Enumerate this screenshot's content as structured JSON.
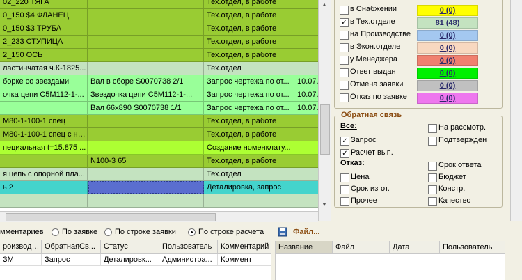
{
  "grid": {
    "rows": [
      {
        "cells": [
          "02_220 ТЯГА",
          "",
          "Тех.отдел, в работе",
          ""
        ],
        "color": "#99cc33"
      },
      {
        "cells": [
          "0_150 $4 ФЛАНЕЦ",
          "",
          "Тех.отдел, в работе",
          ""
        ],
        "color": "#99cc33"
      },
      {
        "cells": [
          "0_150 $3 ТРУБА",
          "",
          "Тех.отдел, в работе",
          ""
        ],
        "color": "#99cc33"
      },
      {
        "cells": [
          "2_233 СТУПИЦА",
          "",
          "Тех.отдел, в работе",
          ""
        ],
        "color": "#99cc33"
      },
      {
        "cells": [
          "2_150 ОСЬ",
          "",
          "Тех.отдел, в работе",
          ""
        ],
        "color": "#99cc33"
      },
      {
        "cells": [
          "ластинчатая ч.К-1825...",
          "",
          "Тех.отдел",
          ""
        ],
        "color": "#c4e3c0"
      },
      {
        "cells": [
          "борке со звездами",
          "Вал в сборе S0070738 2/1",
          "Запрос чертежа по от...",
          "10.07."
        ],
        "color": "#99ff99"
      },
      {
        "cells": [
          "очка цепи C5M112-1-...",
          "Звездочка цепи C5M112-1-...",
          "Запрос чертежа по от...",
          "10.07."
        ],
        "color": "#99ff99"
      },
      {
        "cells": [
          "",
          "Вал 66x890 S0070738 1/1",
          "Запрос чертежа по от...",
          "10.07."
        ],
        "color": "#99ff99"
      },
      {
        "cells": [
          "М80-1-100-1 спец",
          "",
          "Тех.отдел, в работе",
          ""
        ],
        "color": "#99cc33"
      },
      {
        "cells": [
          "М80-1-100-1 спец с на...",
          "",
          "Тех.отдел, в работе",
          ""
        ],
        "color": "#99cc33"
      },
      {
        "cells": [
          "пециальная t=15.875 ...",
          "",
          "Создание номенклату...",
          ""
        ],
        "color": "#adff33"
      },
      {
        "cells": [
          "",
          "N100-3 65",
          "Тех.отдел, в работе",
          ""
        ],
        "color": "#99cc33"
      },
      {
        "cells": [
          "я цепь с опорной пла...",
          "",
          "Тех.отдел",
          ""
        ],
        "color": "#c4e3c0"
      },
      {
        "cells": [
          "ь 2",
          "",
          "Деталировка, запрос",
          ""
        ],
        "color": "#44d4cc"
      },
      {
        "cells": [
          "",
          "",
          "",
          ""
        ],
        "color": "#c4e3c0"
      }
    ]
  },
  "status_filters": [
    {
      "label": "в Снабжении",
      "count": "0 (0)",
      "checked": false,
      "color": "#ffff00"
    },
    {
      "label": "в Тех.отделе",
      "count": "81 (48)",
      "checked": true,
      "color": "#c4e3c0"
    },
    {
      "label": "на Производстве",
      "count": "0 (0)",
      "checked": false,
      "color": "#a4c8f0"
    },
    {
      "label": "в Экон.отделе",
      "count": "0 (0)",
      "checked": false,
      "color": "#f8d8c0"
    },
    {
      "label": "у Менеджера",
      "count": "0 (0)",
      "checked": false,
      "color": "#f08070"
    },
    {
      "label": "Ответ выдан",
      "count": "0 (0)",
      "checked": false,
      "color": "#00f000"
    },
    {
      "label": "Отмена заявки",
      "count": "0 (0)",
      "checked": false,
      "color": "#c0c0c0"
    },
    {
      "label": "Отказ по заявке",
      "count": "0 (0)",
      "checked": false,
      "color": "#ee77ee"
    }
  ],
  "feedback": {
    "title": "Обратная связь",
    "all_label": "Все:",
    "refusal_label": "Отказ:",
    "items": [
      {
        "label": "На рассмотр.",
        "checked": false
      },
      {
        "label": "Запрос",
        "checked": true
      },
      {
        "label": "Подтвержден",
        "checked": false
      },
      {
        "label": "Расчет вып.",
        "checked": true
      },
      {
        "label": "Срок ответа",
        "checked": false
      },
      {
        "label": "Цена",
        "checked": false
      },
      {
        "label": "Бюджет",
        "checked": false
      },
      {
        "label": "Срок изгот.",
        "checked": false
      },
      {
        "label": "Констр.",
        "checked": false
      },
      {
        "label": "Прочее",
        "checked": false
      },
      {
        "label": "Качество",
        "checked": false
      }
    ]
  },
  "comments_radio": {
    "prefix": "мментариев",
    "options": [
      "По заявке",
      "По строке заявки",
      "По строке расчета"
    ],
    "selected": 2
  },
  "comments_table": {
    "headers": [
      "роизводи...",
      "ОбратнаяСв...",
      "Статус",
      "Пользователь",
      "Комментарий"
    ],
    "row": [
      "ЗМ",
      "Запрос",
      "Деталировк...",
      "Администра...",
      "Коммент"
    ]
  },
  "files": {
    "title": "Файл...",
    "headers": [
      "Название",
      "Файл",
      "Дата",
      "Пользователь"
    ]
  }
}
